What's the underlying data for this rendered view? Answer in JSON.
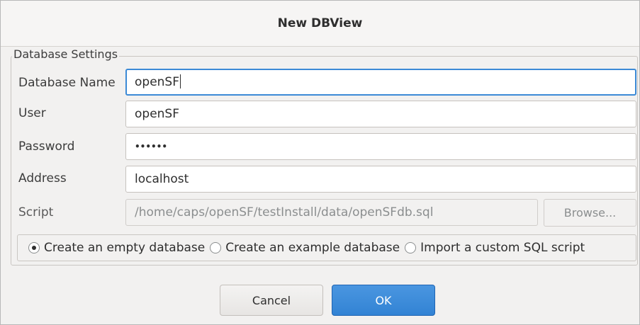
{
  "window": {
    "title": "New DBView"
  },
  "group": {
    "label": "Database Settings"
  },
  "fields": {
    "database_name": {
      "label": "Database Name",
      "value": "openSF"
    },
    "user": {
      "label": "User",
      "value": "openSF"
    },
    "password": {
      "label": "Password",
      "value": "••••••"
    },
    "address": {
      "label": "Address",
      "value": "localhost"
    },
    "script": {
      "label": "Script",
      "value": "/home/caps/openSF/testInstall/data/openSFdb.sql",
      "browse_label": "Browse..."
    }
  },
  "options": {
    "selected": "empty",
    "empty": "Create an empty database",
    "example": "Create an example database",
    "custom": "Import a custom SQL script"
  },
  "buttons": {
    "cancel": "Cancel",
    "ok": "OK"
  },
  "colors": {
    "accent": "#3c8ad6",
    "ok_button": "#3283d4"
  }
}
